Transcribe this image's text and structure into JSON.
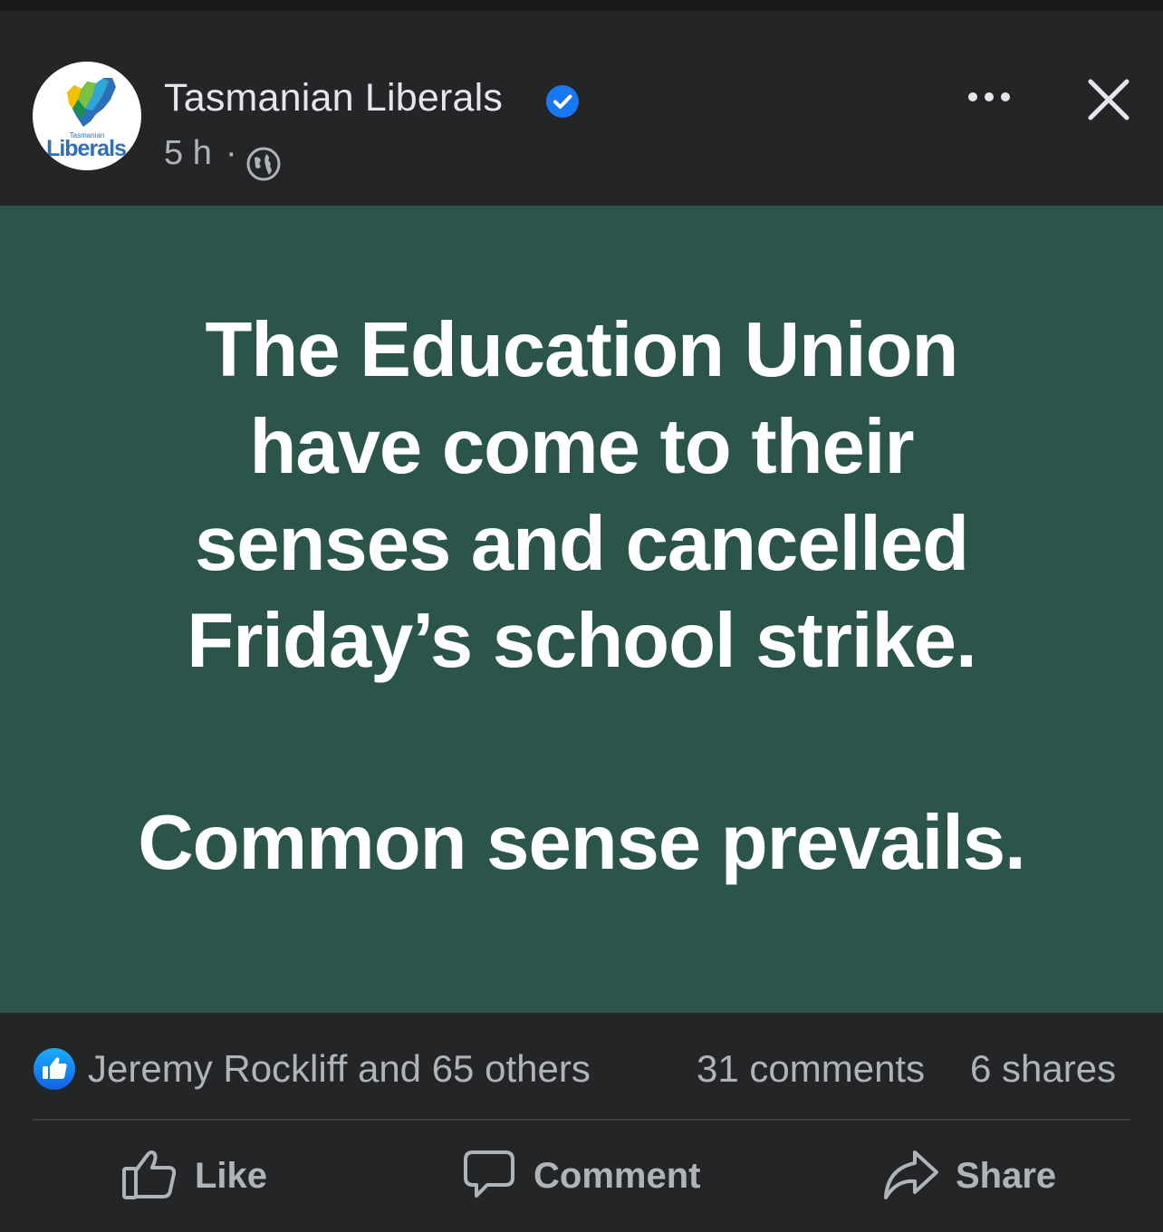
{
  "post": {
    "author": "Tasmanian Liberals",
    "timestamp": "5 h",
    "separator": "·",
    "audience_icon": "globe-icon",
    "verified_icon": "verified-badge-icon",
    "avatar": {
      "small_text": "Tasmanian",
      "brand_text": "Liberals"
    },
    "image_text": {
      "lines": [
        "The Education Union",
        "have come to their",
        "senses and cancelled",
        "Friday’s school strike."
      ],
      "tagline": "Common sense prevails."
    }
  },
  "engagement": {
    "reactions": "Jeremy Rockliff and 65 others",
    "comments": "31 comments",
    "shares": "6 shares"
  },
  "actions": {
    "like": "Like",
    "comment": "Comment",
    "share": "Share"
  },
  "colors": {
    "background": "#242526",
    "post_image_bg": "#2b554a",
    "accent_blue": "#1877f2",
    "secondary_text": "#b0b3b8"
  }
}
